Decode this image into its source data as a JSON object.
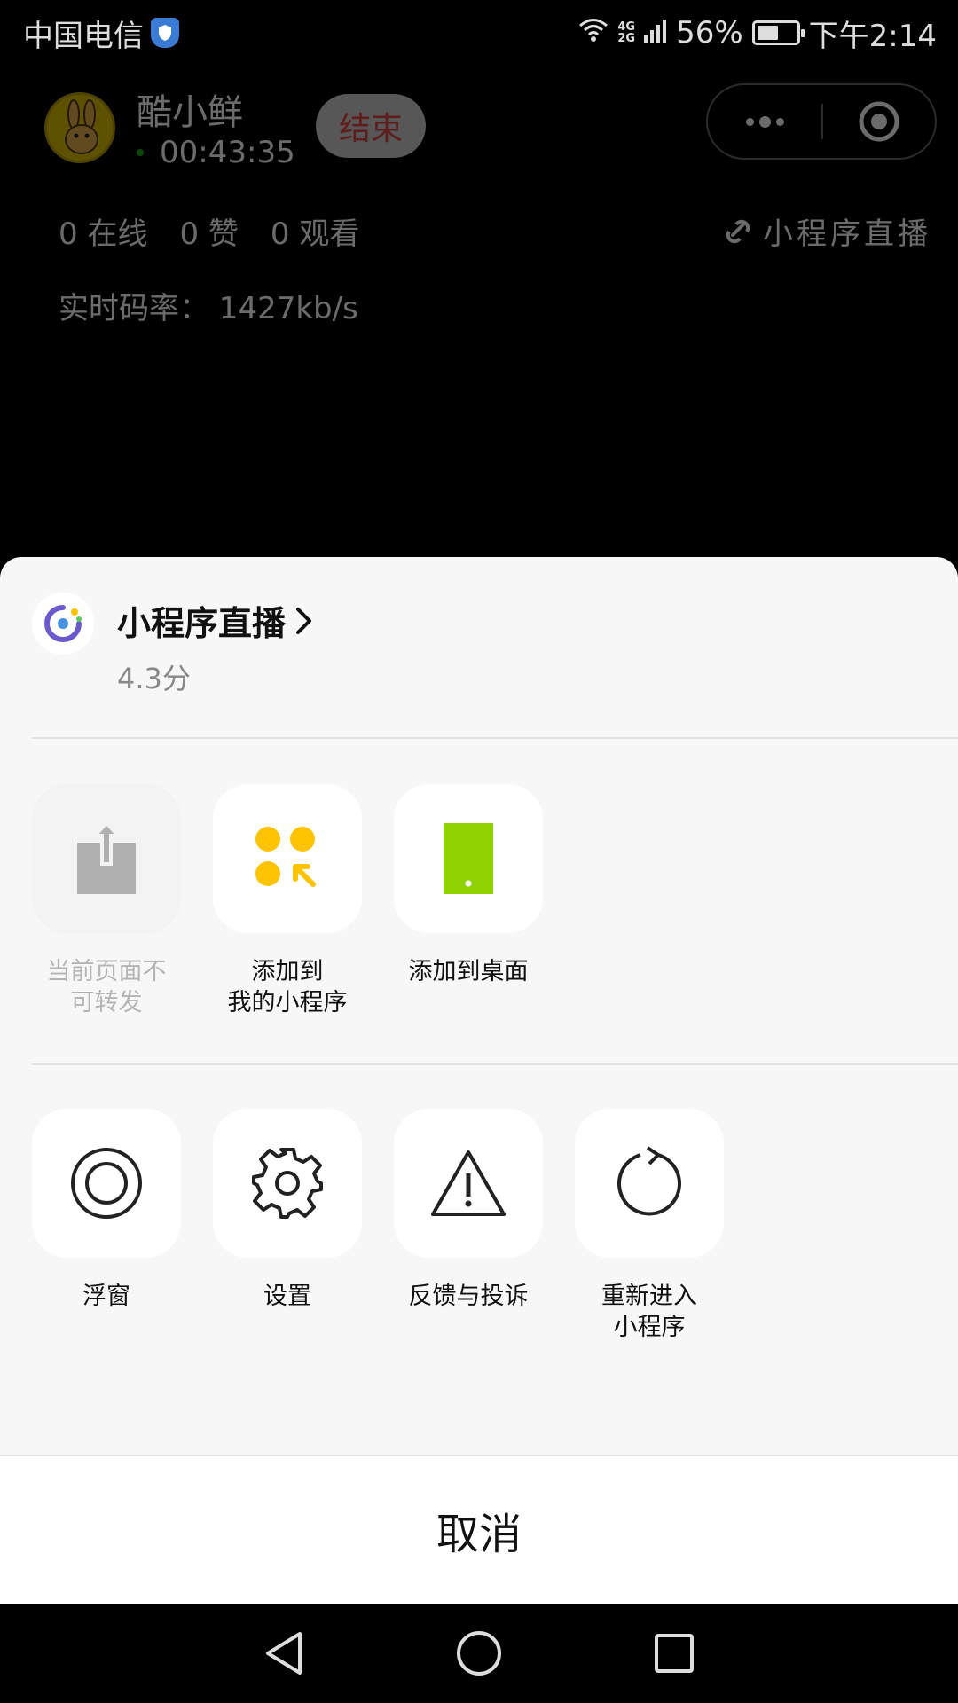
{
  "status_bar": {
    "carrier": "中国电信",
    "network": "4G\n2G",
    "battery": "56%",
    "battery_level": 0.56,
    "time": "下午2:14"
  },
  "live": {
    "host_name": "酷小鲜",
    "timer": "00:43:35",
    "end_label": "结束",
    "online": "0 在线",
    "likes": "0 赞",
    "views": "0 观看",
    "brand": "小程序直播",
    "bitrate": "实时码率： 1427kb/s"
  },
  "sheet": {
    "app_name": "小程序直播",
    "rating": "4.3分",
    "row1": [
      {
        "label": "当前页面不\n可转发",
        "icon": "share-icon",
        "disabled": true
      },
      {
        "label": "添加到\n我的小程序",
        "icon": "add-to-my-miniprogram-icon",
        "disabled": false
      },
      {
        "label": "添加到桌面",
        "icon": "add-to-desktop-icon",
        "disabled": false
      }
    ],
    "row2": [
      {
        "label": "浮窗",
        "icon": "floating-window-icon"
      },
      {
        "label": "设置",
        "icon": "gear-icon"
      },
      {
        "label": "反馈与投诉",
        "icon": "warning-icon"
      },
      {
        "label": "重新进入\n小程序",
        "icon": "reload-icon"
      }
    ],
    "cancel_label": "取消"
  },
  "colors": {
    "accent_yellow": "#ffc300",
    "accent_green": "#91d300",
    "end_red": "#e04545"
  }
}
